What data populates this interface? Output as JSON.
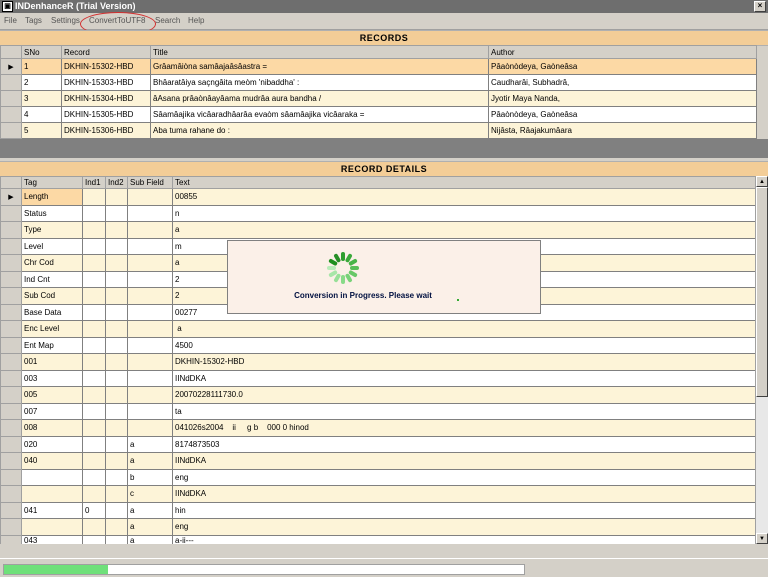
{
  "window": {
    "title": "INDenhanceR (Trial Version)",
    "close_label": "×"
  },
  "menu": {
    "items": [
      "File",
      "Tags",
      "Settings",
      "ConvertToUTF8",
      "Search",
      "Help"
    ]
  },
  "records": {
    "header": "RECORDS",
    "columns": [
      "SNo",
      "Record",
      "Title",
      "Author"
    ],
    "rows": [
      [
        "1",
        "DKHIN-15302-HBD",
        "Grâamâiòna samâajaâsâastra =",
        "Pâaònòdeya, Gaòneâsa"
      ],
      [
        "2",
        "DKHIN-15303-HBD",
        "Bhâaratâiya saçngâita meòm 'nibaddha' :",
        "Caudharâi, Subhadrâ,"
      ],
      [
        "3",
        "DKHIN-15304-HBD",
        "âAsana prâaònâayâama mudrâa aura bandha /",
        "Jyotir Maya Nanda,"
      ],
      [
        "4",
        "DKHIN-15305-HBD",
        "Sâamâajika vicâaradhâarâa evaòm sâamâajika vicâaraka =",
        "Pâaònòdeya, Gaòneâsa"
      ],
      [
        "5",
        "DKHIN-15306-HBD",
        "Aba tuma rahane do :",
        "Nijâsta, Râajakumâara"
      ]
    ]
  },
  "details": {
    "header": "RECORD DETAILS",
    "columns": [
      "Tag",
      "Ind1",
      "Ind2",
      "Sub Field",
      "Text"
    ],
    "rows": [
      [
        "Length",
        "",
        "",
        "",
        "00855"
      ],
      [
        "Status",
        "",
        "",
        "",
        "n"
      ],
      [
        "Type",
        "",
        "",
        "",
        "a"
      ],
      [
        "Level",
        "",
        "",
        "",
        "m"
      ],
      [
        "Chr Cod",
        "",
        "",
        "",
        "a"
      ],
      [
        "Ind Cnt",
        "",
        "",
        "",
        "2"
      ],
      [
        "Sub Cod",
        "",
        "",
        "",
        "2"
      ],
      [
        "Base Data",
        "",
        "",
        "",
        "00277"
      ],
      [
        "Enc Level",
        "",
        "",
        "",
        " a"
      ],
      [
        "Ent Map",
        "",
        "",
        "",
        "4500"
      ],
      [
        "001",
        "",
        "",
        "",
        "DKHIN-15302-HBD"
      ],
      [
        "003",
        "",
        "",
        "",
        "IINdDKA"
      ],
      [
        "005",
        "",
        "",
        "",
        "20070228111730.0"
      ],
      [
        "007",
        "",
        "",
        "",
        "ta"
      ],
      [
        "008",
        "",
        "",
        "",
        "041026s2004    ii     g b    000 0 hinod"
      ],
      [
        "020",
        "",
        "",
        "a",
        "8174873503"
      ],
      [
        "040",
        "",
        "",
        "a",
        "IINdDKA"
      ],
      [
        "",
        "",
        "",
        "b",
        "eng"
      ],
      [
        "",
        "",
        "",
        "c",
        "IINdDKA"
      ],
      [
        "041",
        "0",
        "",
        "a",
        "hin"
      ],
      [
        "",
        "",
        "",
        "a",
        "eng"
      ],
      [
        "043",
        "",
        "",
        "a",
        "a-ii---"
      ]
    ]
  },
  "dialog": {
    "message": "Conversion in Progress. Please wait",
    "icon": "spinner-icon"
  },
  "status": {
    "progress_fraction": 0.2
  },
  "colors": {
    "header": "#f3cd97",
    "current_row": "#fcd9a5",
    "alt_row": "#fdf4d8",
    "progress": "#6fe07a"
  }
}
